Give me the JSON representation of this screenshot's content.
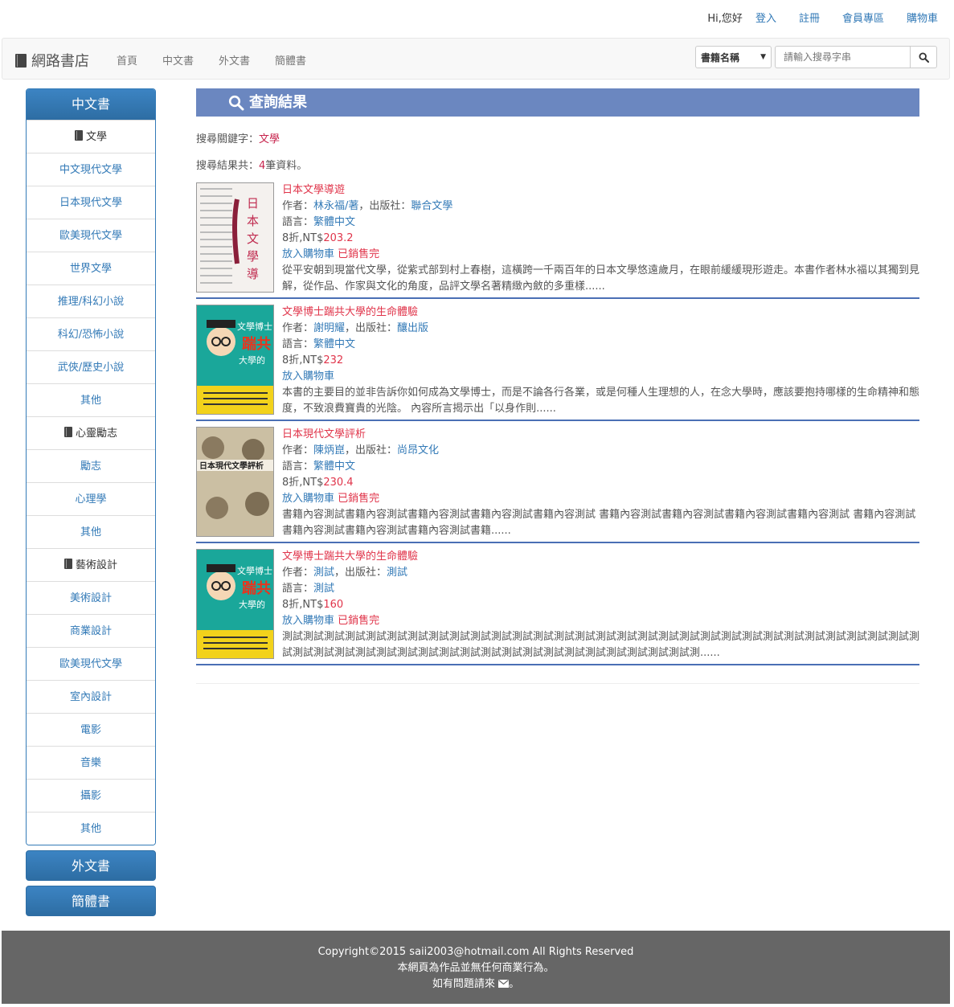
{
  "topbar": {
    "greeting": "Hi,您好",
    "login": "登入",
    "register": "註冊",
    "member": "會員專區",
    "cart": "購物車"
  },
  "navbar": {
    "brand": "網路書店",
    "links": [
      "首頁",
      "中文書",
      "外文書",
      "簡體書"
    ],
    "search_select": "書籍名稱",
    "search_placeholder": "請輸入搜尋字串"
  },
  "sidebar": {
    "panel_title": "中文書",
    "items": [
      {
        "label": "文學",
        "type": "category"
      },
      {
        "label": "中文現代文學",
        "type": "link"
      },
      {
        "label": "日本現代文學",
        "type": "link"
      },
      {
        "label": "歐美現代文學",
        "type": "link"
      },
      {
        "label": "世界文學",
        "type": "link"
      },
      {
        "label": "推理/科幻小說",
        "type": "link"
      },
      {
        "label": "科幻/恐怖小說",
        "type": "link"
      },
      {
        "label": "武俠/歷史小說",
        "type": "link"
      },
      {
        "label": "其他",
        "type": "link"
      },
      {
        "label": "心靈勵志",
        "type": "category"
      },
      {
        "label": "勵志",
        "type": "link"
      },
      {
        "label": "心理學",
        "type": "link"
      },
      {
        "label": "其他",
        "type": "link"
      },
      {
        "label": "藝術設計",
        "type": "category"
      },
      {
        "label": "美術設計",
        "type": "link"
      },
      {
        "label": "商業設計",
        "type": "link"
      },
      {
        "label": "歐美現代文學",
        "type": "link"
      },
      {
        "label": "室內設計",
        "type": "link"
      },
      {
        "label": "電影",
        "type": "link"
      },
      {
        "label": "音樂",
        "type": "link"
      },
      {
        "label": "攝影",
        "type": "link"
      },
      {
        "label": "其他",
        "type": "link"
      }
    ],
    "foreign_btn": "外文書",
    "simplified_btn": "簡體書"
  },
  "results": {
    "heading": "查詢結果",
    "keyword_label": "搜尋關鍵字：",
    "keyword": "文學",
    "count_prefix": "搜尋結果共：",
    "count": "4",
    "count_suffix": "筆資料。",
    "books": [
      {
        "title": "日本文學導遊",
        "author_label": "作者：",
        "author": "林永福/著",
        "publisher_label": "，出版社：",
        "publisher": "聯合文學",
        "lang_label": "語言：",
        "lang": "繁體中文",
        "discount": "8折,NT$",
        "price": "203.2",
        "cart": "放入購物車",
        "soldout": "已銷售完",
        "desc": "從平安朝到現當代文學，從紫式部到村上春樹，這橫跨一千兩百年的日本文學悠遠歲月，在眼前緩緩現形遊走。本書作者林水福以其獨到見解，從作品、作家與文化的角度，品評文學名著精緻內斂的多重樣......",
        "cover_color": "#f4f1ee"
      },
      {
        "title": "文學博士踹共大學的生命體驗",
        "author_label": "作者：",
        "author": "謝明耀",
        "publisher_label": "，出版社：",
        "publisher": "釀出版",
        "lang_label": "語言：",
        "lang": "繁體中文",
        "discount": "8折,NT$",
        "price": "232",
        "cart": "放入購物車",
        "soldout": "",
        "desc": "本書的主要目的並非告訴你如何成為文學博士，而是不論各行各業，或是何種人生理想的人，在念大學時，應該要抱持哪樣的生命精神和態度，不致浪費寶貴的光陰。 內容所言揭示出「以身作則......",
        "cover_color": "#1aa79a"
      },
      {
        "title": "日本現代文學評析",
        "author_label": "作者：",
        "author": "陳炳崑",
        "publisher_label": "，出版社：",
        "publisher": "尚昂文化",
        "lang_label": "語言：",
        "lang": "繁體中文",
        "discount": "8折,NT$",
        "price": "230.4",
        "cart": "放入購物車",
        "soldout": "已銷售完",
        "desc": "書籍內容測試書籍內容測試書籍內容測試書籍內容測試書籍內容測試 書籍內容測試書籍內容測試書籍內容測試書籍內容測試 書籍內容測試書籍內容測試書籍內容測試書籍內容測試書籍......",
        "cover_color": "#cbbfa3"
      },
      {
        "title": "文學博士踹共大學的生命體驗",
        "author_label": "作者：",
        "author": "測試",
        "publisher_label": "，出版社：",
        "publisher": "測試",
        "lang_label": "語言：",
        "lang": "測試",
        "discount": "8折,NT$",
        "price": "160",
        "cart": "放入購物車",
        "soldout": "已銷售完",
        "desc": "測試測試測試測試測試測試測試測試測試測試測試測試測試測試測試測試測試測試測試測試測試測試測試測試測試測試測試測試測試測試測試測試測試測試測試測試測試測試測試測試測試測試測試測試測試測試測試測試測試測試測......",
        "cover_color": "#1aa79a"
      }
    ]
  },
  "footer": {
    "line1": "Copyright©2015 saii2003@hotmail.com All Rights Reserved",
    "line2": "本網頁為作品並無任何商業行為。",
    "line3_pre": "如有問題請來",
    "line3_post": "。"
  }
}
